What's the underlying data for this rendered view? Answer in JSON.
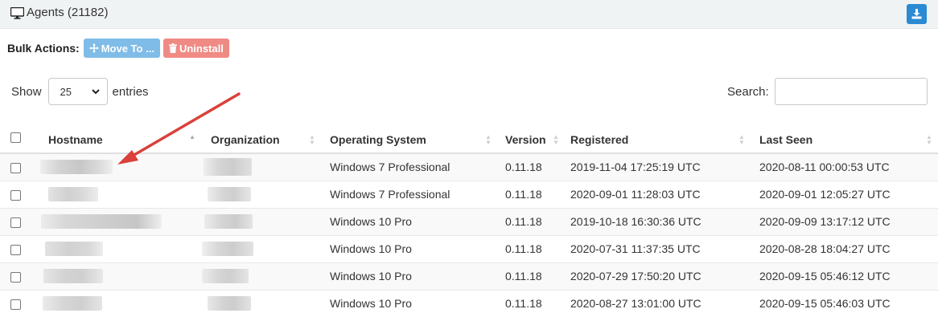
{
  "header": {
    "title": "Agents (21182)",
    "icons": {
      "monitor": "desktop-monitor-icon",
      "download": "download-icon"
    }
  },
  "bulk_actions": {
    "label": "Bulk Actions:",
    "move_to": "Move To ...",
    "uninstall": "Uninstall"
  },
  "length": {
    "show": "Show",
    "value": "25",
    "entries": "entries"
  },
  "search": {
    "label": "Search:",
    "value": ""
  },
  "table": {
    "columns": [
      "Hostname",
      "Organization",
      "Operating System",
      "Version",
      "Registered",
      "Last Seen"
    ],
    "rows": [
      {
        "os": "Windows 7 Professional",
        "version": "0.11.18",
        "registered": "2019-11-04 17:25:19 UTC",
        "last_seen": "2020-08-11 00:00:53 UTC"
      },
      {
        "os": "Windows 7 Professional",
        "version": "0.11.18",
        "registered": "2020-09-01 11:28:03 UTC",
        "last_seen": "2020-09-01 12:05:27 UTC"
      },
      {
        "os": "Windows 10 Pro",
        "version": "0.11.18",
        "registered": "2019-10-18 16:30:36 UTC",
        "last_seen": "2020-09-09 13:17:12 UTC"
      },
      {
        "os": "Windows 10 Pro",
        "version": "0.11.18",
        "registered": "2020-07-31 11:37:35 UTC",
        "last_seen": "2020-08-28 18:04:27 UTC"
      },
      {
        "os": "Windows 10 Pro",
        "version": "0.11.18",
        "registered": "2020-07-29 17:50:20 UTC",
        "last_seen": "2020-09-15 05:46:12 UTC"
      },
      {
        "os": "Windows 10 Pro",
        "version": "0.11.18",
        "registered": "2020-08-27 13:01:00 UTC",
        "last_seen": "2020-09-15 05:46:03 UTC"
      }
    ]
  },
  "colors": {
    "download": "#2a8ad4",
    "move_to": "#7fbce8",
    "uninstall": "#f08a84",
    "arrow": "#d9413a"
  }
}
